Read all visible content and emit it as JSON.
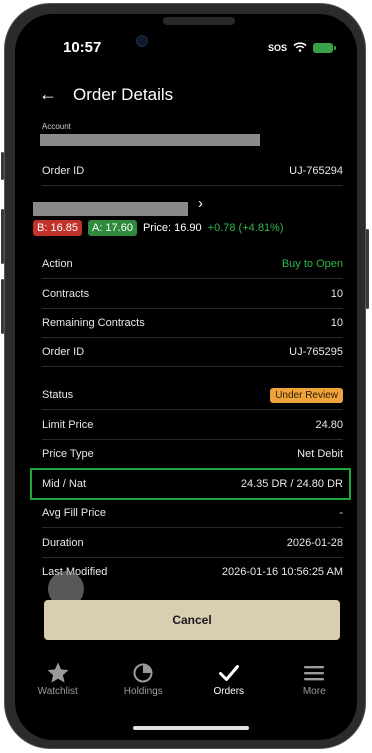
{
  "status_bar": {
    "time": "10:57",
    "sos": "SOS"
  },
  "header": {
    "title": "Order Details"
  },
  "account": {
    "label": "Account"
  },
  "order_id_top": {
    "label": "Order ID",
    "value": "UJ-765294"
  },
  "quote": {
    "bid": "B: 16.85",
    "ask": "A: 17.60",
    "price": "Price: 16.90",
    "change": "+0.78 (+4.81%)"
  },
  "rows": [
    {
      "label": "Action",
      "value": "Buy to Open"
    },
    {
      "label": "Contracts",
      "value": "10"
    },
    {
      "label": "Remaining Contracts",
      "value": "10"
    },
    {
      "label": "Order ID",
      "value": "UJ-765295"
    },
    {
      "label": "Status",
      "value": "Under Review"
    },
    {
      "label": "Limit Price",
      "value": "24.80"
    },
    {
      "label": "Price Type",
      "value": "Net Debit"
    },
    {
      "label": "Mid / Nat",
      "value": "24.35 DR / 24.80 DR"
    },
    {
      "label": "Avg Fill Price",
      "value": "-"
    },
    {
      "label": "Duration",
      "value": "2026-01-28"
    },
    {
      "label": "Last Modified",
      "value": "2026-01-16 10:56:25 AM"
    }
  ],
  "cancel_button": {
    "label": "Cancel"
  },
  "tabs": [
    {
      "label": "Watchlist",
      "icon": "star-icon"
    },
    {
      "label": "Holdings",
      "icon": "pie-chart-icon"
    },
    {
      "label": "Orders",
      "icon": "checkmark-icon"
    },
    {
      "label": "More",
      "icon": "menu-icon"
    }
  ],
  "colors": {
    "positive": "#2fb54a",
    "bid": "#c0322b",
    "ask": "#2e8b3e",
    "status_badge": "#f0a33a",
    "highlight": "#1fa83a",
    "cancel_bg": "#d9cfb0"
  }
}
